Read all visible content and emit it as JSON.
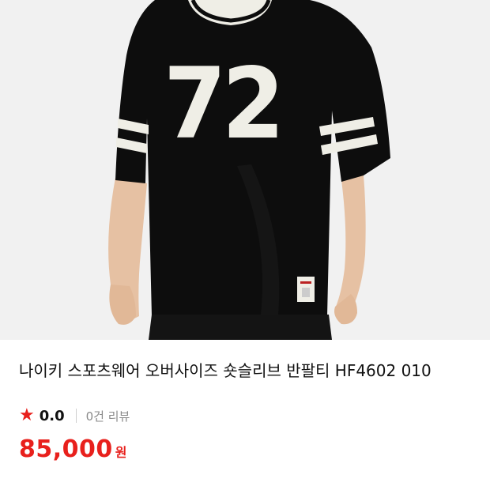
{
  "product": {
    "title": "나이키 스포츠웨어 오버사이즈 숏슬리브 반팔티 HF4602 010",
    "jersey_number": "72",
    "rating_value": "0.0",
    "review_count": "0건 리뷰",
    "price_value": "85,000",
    "price_unit": "원"
  },
  "icons": {
    "rating": "star-icon"
  },
  "colors": {
    "accent": "#e8201c",
    "shirt": "#0d0d0d",
    "stripe": "#efeee6"
  }
}
